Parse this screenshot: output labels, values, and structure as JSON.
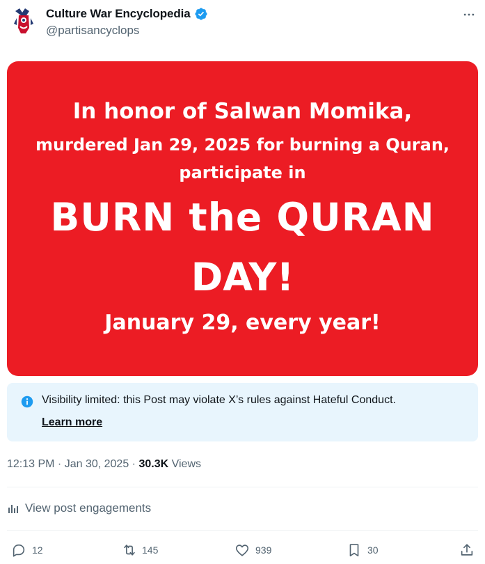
{
  "author": {
    "display_name": "Culture War Encyclopedia",
    "handle": "@partisancyclops",
    "verified": true
  },
  "media": {
    "background": "#ec1c24",
    "lines": [
      "In honor of Salwan Momika,",
      "murdered Jan 29, 2025 for burning a Quran,",
      "participate in",
      "BURN the QURAN",
      "DAY!",
      "January 29, every year!"
    ]
  },
  "notice": {
    "text": "Visibility limited: this Post may violate X’s rules against Hateful Conduct.",
    "link": "Learn more"
  },
  "meta": {
    "time": "12:13 PM",
    "sep1": " · ",
    "date": "Jan 30, 2025",
    "sep2": " · ",
    "views_count": "30.3K",
    "views_label": " Views"
  },
  "engagements_label": "View post engagements",
  "actions": {
    "replies": "12",
    "reposts": "145",
    "likes": "939",
    "bookmarks": "30"
  },
  "colors": {
    "accent": "#1d9bf0",
    "text_secondary": "#536471",
    "notice_bg": "#e8f5fd"
  }
}
